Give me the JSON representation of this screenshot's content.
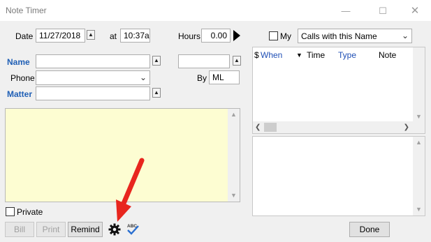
{
  "window": {
    "title": "Note Timer",
    "minimize_icon": "minimize-icon",
    "maximize_icon": "maximize-icon",
    "close_icon": "close-icon"
  },
  "timing": {
    "date_label": "Date",
    "date_value": "11/27/2018",
    "at_label": "at",
    "time_value": "10:37a",
    "hours_label": "Hours",
    "hours_value": "0.00"
  },
  "form": {
    "name_label": "Name",
    "name_value": "",
    "phone_label": "Phone",
    "phone_value": "",
    "matter_label": "Matter",
    "matter_value": "",
    "extra_value": "",
    "by_label": "By",
    "by_value": "ML"
  },
  "notes": {
    "text": ""
  },
  "private": {
    "label": "Private",
    "checked": false
  },
  "buttons": {
    "bill": "Bill",
    "print": "Print",
    "remind": "Remind",
    "done": "Done"
  },
  "icons": {
    "settings": "gear-icon",
    "spellcheck": "spellcheck-icon",
    "annotation": "red-arrow-annotation"
  },
  "filter": {
    "my_label": "My",
    "my_checked": false,
    "selected": "Calls with this Name"
  },
  "calls_table": {
    "columns": [
      "$",
      "When",
      "Time",
      "Type",
      "Note"
    ],
    "rows": []
  }
}
